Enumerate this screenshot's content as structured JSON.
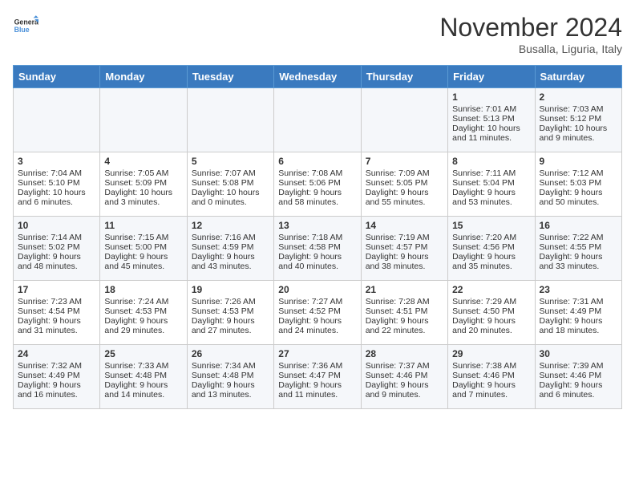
{
  "header": {
    "logo_line1": "General",
    "logo_line2": "Blue",
    "month_title": "November 2024",
    "location": "Busalla, Liguria, Italy"
  },
  "days_of_week": [
    "Sunday",
    "Monday",
    "Tuesday",
    "Wednesday",
    "Thursday",
    "Friday",
    "Saturday"
  ],
  "weeks": [
    [
      {
        "day": "",
        "content": ""
      },
      {
        "day": "",
        "content": ""
      },
      {
        "day": "",
        "content": ""
      },
      {
        "day": "",
        "content": ""
      },
      {
        "day": "",
        "content": ""
      },
      {
        "day": "1",
        "content": "Sunrise: 7:01 AM\nSunset: 5:13 PM\nDaylight: 10 hours and 11 minutes."
      },
      {
        "day": "2",
        "content": "Sunrise: 7:03 AM\nSunset: 5:12 PM\nDaylight: 10 hours and 9 minutes."
      }
    ],
    [
      {
        "day": "3",
        "content": "Sunrise: 7:04 AM\nSunset: 5:10 PM\nDaylight: 10 hours and 6 minutes."
      },
      {
        "day": "4",
        "content": "Sunrise: 7:05 AM\nSunset: 5:09 PM\nDaylight: 10 hours and 3 minutes."
      },
      {
        "day": "5",
        "content": "Sunrise: 7:07 AM\nSunset: 5:08 PM\nDaylight: 10 hours and 0 minutes."
      },
      {
        "day": "6",
        "content": "Sunrise: 7:08 AM\nSunset: 5:06 PM\nDaylight: 9 hours and 58 minutes."
      },
      {
        "day": "7",
        "content": "Sunrise: 7:09 AM\nSunset: 5:05 PM\nDaylight: 9 hours and 55 minutes."
      },
      {
        "day": "8",
        "content": "Sunrise: 7:11 AM\nSunset: 5:04 PM\nDaylight: 9 hours and 53 minutes."
      },
      {
        "day": "9",
        "content": "Sunrise: 7:12 AM\nSunset: 5:03 PM\nDaylight: 9 hours and 50 minutes."
      }
    ],
    [
      {
        "day": "10",
        "content": "Sunrise: 7:14 AM\nSunset: 5:02 PM\nDaylight: 9 hours and 48 minutes."
      },
      {
        "day": "11",
        "content": "Sunrise: 7:15 AM\nSunset: 5:00 PM\nDaylight: 9 hours and 45 minutes."
      },
      {
        "day": "12",
        "content": "Sunrise: 7:16 AM\nSunset: 4:59 PM\nDaylight: 9 hours and 43 minutes."
      },
      {
        "day": "13",
        "content": "Sunrise: 7:18 AM\nSunset: 4:58 PM\nDaylight: 9 hours and 40 minutes."
      },
      {
        "day": "14",
        "content": "Sunrise: 7:19 AM\nSunset: 4:57 PM\nDaylight: 9 hours and 38 minutes."
      },
      {
        "day": "15",
        "content": "Sunrise: 7:20 AM\nSunset: 4:56 PM\nDaylight: 9 hours and 35 minutes."
      },
      {
        "day": "16",
        "content": "Sunrise: 7:22 AM\nSunset: 4:55 PM\nDaylight: 9 hours and 33 minutes."
      }
    ],
    [
      {
        "day": "17",
        "content": "Sunrise: 7:23 AM\nSunset: 4:54 PM\nDaylight: 9 hours and 31 minutes."
      },
      {
        "day": "18",
        "content": "Sunrise: 7:24 AM\nSunset: 4:53 PM\nDaylight: 9 hours and 29 minutes."
      },
      {
        "day": "19",
        "content": "Sunrise: 7:26 AM\nSunset: 4:53 PM\nDaylight: 9 hours and 27 minutes."
      },
      {
        "day": "20",
        "content": "Sunrise: 7:27 AM\nSunset: 4:52 PM\nDaylight: 9 hours and 24 minutes."
      },
      {
        "day": "21",
        "content": "Sunrise: 7:28 AM\nSunset: 4:51 PM\nDaylight: 9 hours and 22 minutes."
      },
      {
        "day": "22",
        "content": "Sunrise: 7:29 AM\nSunset: 4:50 PM\nDaylight: 9 hours and 20 minutes."
      },
      {
        "day": "23",
        "content": "Sunrise: 7:31 AM\nSunset: 4:49 PM\nDaylight: 9 hours and 18 minutes."
      }
    ],
    [
      {
        "day": "24",
        "content": "Sunrise: 7:32 AM\nSunset: 4:49 PM\nDaylight: 9 hours and 16 minutes."
      },
      {
        "day": "25",
        "content": "Sunrise: 7:33 AM\nSunset: 4:48 PM\nDaylight: 9 hours and 14 minutes."
      },
      {
        "day": "26",
        "content": "Sunrise: 7:34 AM\nSunset: 4:48 PM\nDaylight: 9 hours and 13 minutes."
      },
      {
        "day": "27",
        "content": "Sunrise: 7:36 AM\nSunset: 4:47 PM\nDaylight: 9 hours and 11 minutes."
      },
      {
        "day": "28",
        "content": "Sunrise: 7:37 AM\nSunset: 4:46 PM\nDaylight: 9 hours and 9 minutes."
      },
      {
        "day": "29",
        "content": "Sunrise: 7:38 AM\nSunset: 4:46 PM\nDaylight: 9 hours and 7 minutes."
      },
      {
        "day": "30",
        "content": "Sunrise: 7:39 AM\nSunset: 4:46 PM\nDaylight: 9 hours and 6 minutes."
      }
    ]
  ]
}
